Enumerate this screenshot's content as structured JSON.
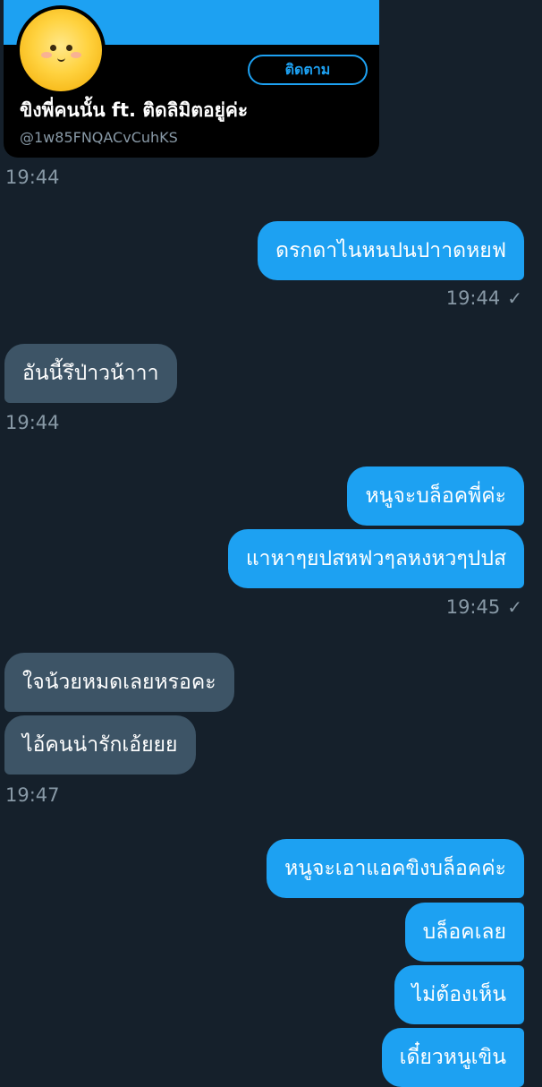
{
  "card": {
    "name": "ขิงพี่คนนั้น ft. ติดลิมิตอยู่ค่ะ",
    "handle": "@1w85FNQACvCuhKS",
    "follow_label": "ติดตาม",
    "avatar": "yellow-chick-avatar",
    "banner_color": "#1da1f2"
  },
  "messages": [
    {
      "type": "time",
      "side": "left",
      "text": "19:44"
    },
    {
      "type": "out",
      "text": "ดรกดาไนหนปนปาาดหยฟ"
    },
    {
      "type": "time",
      "side": "right",
      "text": "19:44",
      "check": "✓"
    },
    {
      "type": "in",
      "text": "อันนี้รึป่าวน้าาา"
    },
    {
      "type": "time",
      "side": "left",
      "text": "19:44"
    },
    {
      "type": "out",
      "text": "หนูจะบล็อคพี่ค่ะ"
    },
    {
      "type": "out",
      "text": "แาหาๆยปสหฟวๆลหงหวๆปปส"
    },
    {
      "type": "time",
      "side": "right",
      "text": "19:45",
      "check": "✓"
    },
    {
      "type": "in",
      "text": "ใจน้วยหมดเลยหรอคะ"
    },
    {
      "type": "in",
      "text": "ไอ้คนน่ารักเอ้ยยย"
    },
    {
      "type": "time",
      "side": "left",
      "text": "19:47"
    },
    {
      "type": "out",
      "text": "หนูจะเอาแอคขิงบล็อคค่ะ"
    },
    {
      "type": "out",
      "text": "บล็อคเลย"
    },
    {
      "type": "out",
      "text": "ไม่ต้องเห็น"
    },
    {
      "type": "out",
      "text": "เดี๋ยวหนูเขิน"
    }
  ],
  "colors": {
    "background": "#15202b",
    "outgoing": "#1da1f2",
    "incoming": "#3d5466",
    "meta": "#8899a6"
  }
}
